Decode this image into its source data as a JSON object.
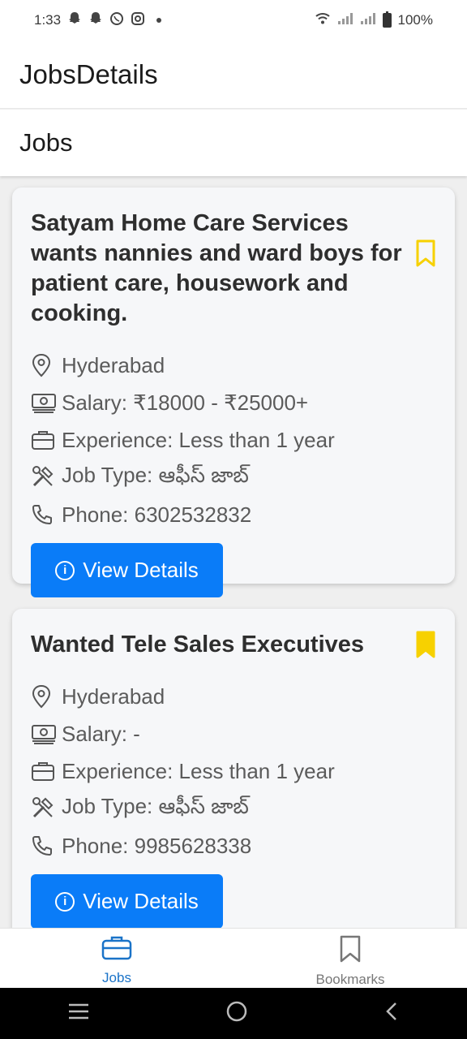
{
  "status_bar": {
    "time": "1:33",
    "battery": "100%",
    "left_icons": [
      "snapchat-icon",
      "snapchat-icon",
      "whatsapp-icon",
      "instagram-icon"
    ],
    "right_icons": [
      "wifi-icon",
      "signal-icon",
      "signal-icon",
      "battery-icon"
    ]
  },
  "app_bar": {
    "title": "JobsDetails"
  },
  "section": {
    "title": "Jobs"
  },
  "jobs": [
    {
      "title": "Satyam Home Care Services wants nannies and ward boys for patient care, housework and cooking.",
      "bookmarked": false,
      "location": "Hyderabad",
      "salary": "Salary: ₹18000 - ₹25000+",
      "experience": "Experience: Less than 1 year",
      "job_type": "Job Type: ఆఫీస్ జాబ్",
      "phone": "Phone: 6302532832",
      "button_label": "View Details"
    },
    {
      "title": "Wanted Tele Sales Executives",
      "bookmarked": true,
      "location": "Hyderabad",
      "salary": "Salary: -",
      "experience": "Experience: Less than 1 year",
      "job_type": "Job Type: ఆఫీస్ జాబ్",
      "phone": "Phone: 9985628338",
      "button_label": "View Details"
    }
  ],
  "bottom_nav": {
    "items": [
      {
        "label": "Jobs",
        "icon": "briefcase-icon",
        "active": true
      },
      {
        "label": "Bookmarks",
        "icon": "bookmark-icon",
        "active": false
      }
    ]
  },
  "colors": {
    "accent": "#0a7cf8",
    "bookmark": "#f7d100",
    "active_nav": "#1a73c8",
    "inactive_nav": "#777777"
  }
}
